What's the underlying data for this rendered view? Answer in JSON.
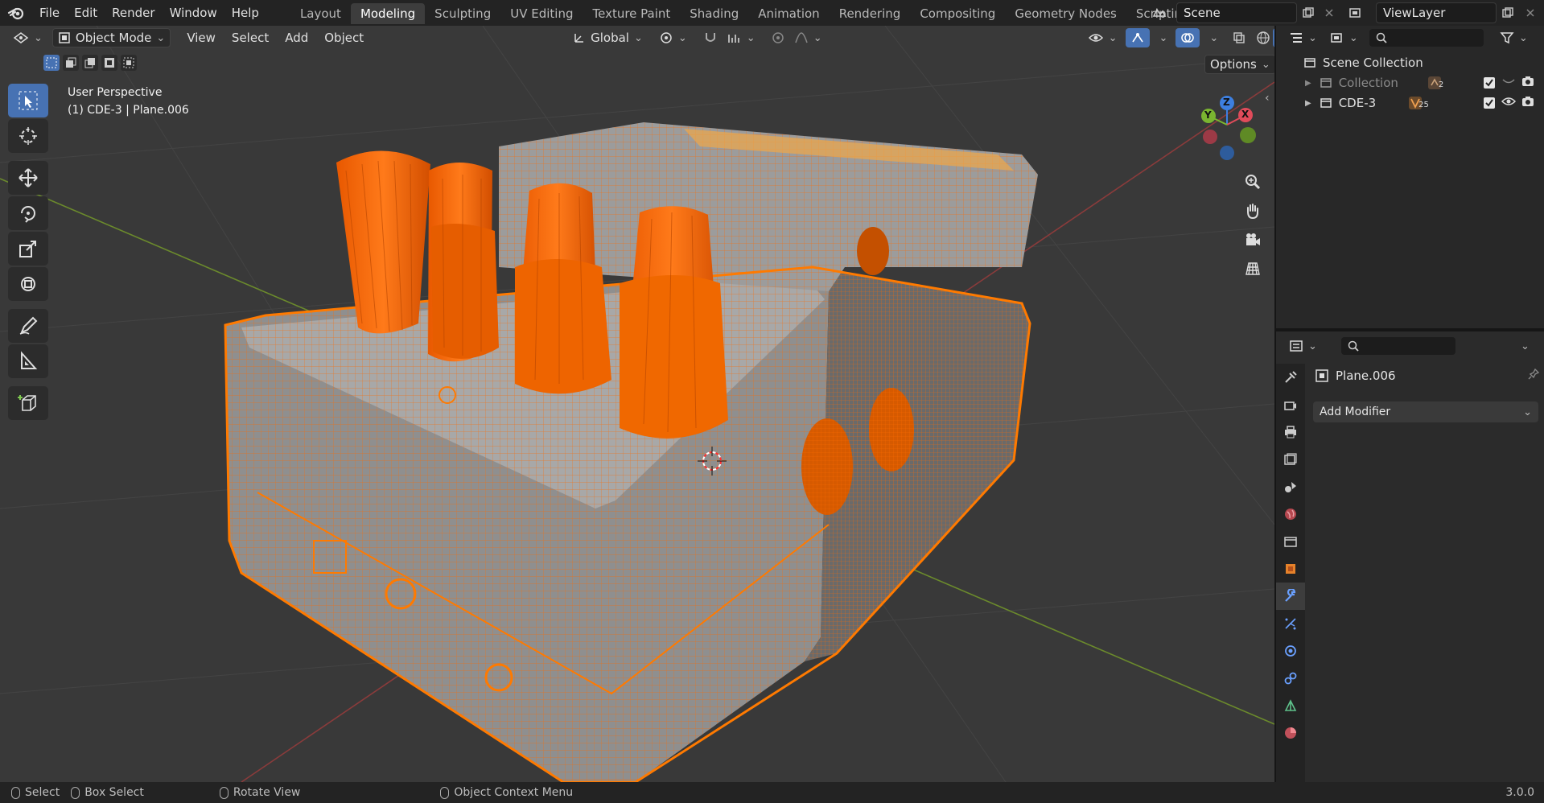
{
  "menu": [
    "File",
    "Edit",
    "Render",
    "Window",
    "Help"
  ],
  "workspaces": [
    {
      "label": "Layout",
      "active": false
    },
    {
      "label": "Modeling",
      "active": true
    },
    {
      "label": "Sculpting",
      "active": false
    },
    {
      "label": "UV Editing",
      "active": false
    },
    {
      "label": "Texture Paint",
      "active": false
    },
    {
      "label": "Shading",
      "active": false
    },
    {
      "label": "Animation",
      "active": false
    },
    {
      "label": "Rendering",
      "active": false
    },
    {
      "label": "Compositing",
      "active": false
    },
    {
      "label": "Geometry Nodes",
      "active": false
    },
    {
      "label": "Scripting",
      "active": false
    }
  ],
  "add_workspace": "+",
  "scene": {
    "name": "Scene"
  },
  "view_layer": {
    "name": "ViewLayer"
  },
  "viewport": {
    "mode": "Object Mode",
    "menus": [
      "View",
      "Select",
      "Add",
      "Object"
    ],
    "transform_orientation": "Global",
    "options_label": "Options",
    "perspective_label": "User Perspective",
    "active_object_label": "(1) CDE-3 | Plane.006",
    "gizmo": {
      "x": "X",
      "y": "Y",
      "z": "Z"
    }
  },
  "outliner": {
    "root": "Scene Collection",
    "items": [
      {
        "label": "Collection",
        "badge": "2"
      },
      {
        "label": "CDE-3",
        "badge": "25"
      }
    ]
  },
  "properties": {
    "object_name": "Plane.006",
    "add_modifier_label": "Add Modifier"
  },
  "statusbar": {
    "select": "Select",
    "box_select": "Box Select",
    "rotate": "Rotate View",
    "context_menu": "Object Context Menu",
    "version": "3.0.0"
  },
  "colors": {
    "accent_blue": "#4772b3",
    "selection_orange": "#ff6a00",
    "viewport_bg": "#393939"
  }
}
